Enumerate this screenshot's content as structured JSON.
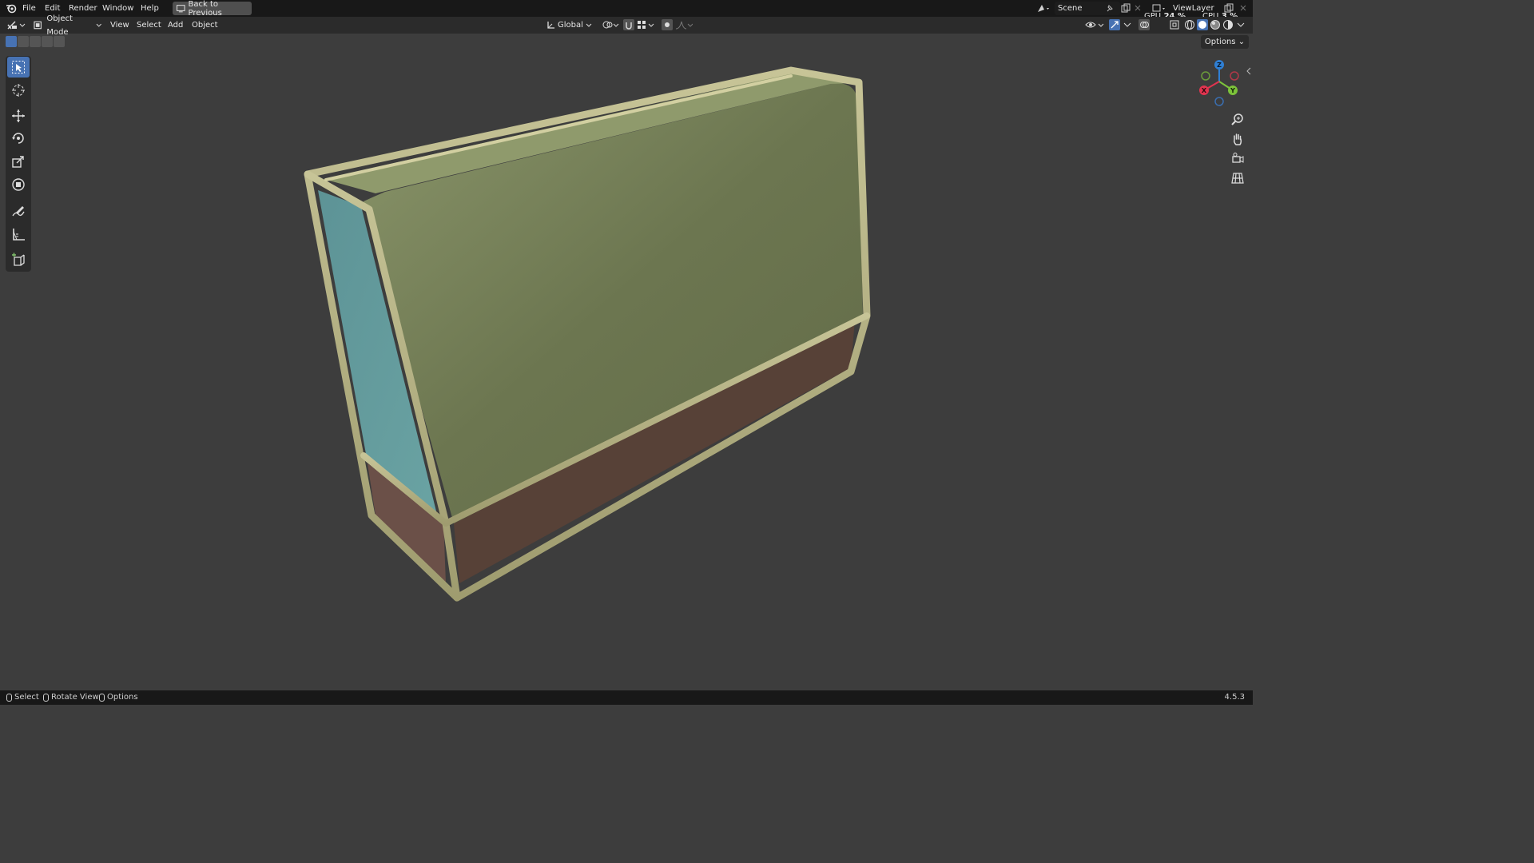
{
  "menu": {
    "items": [
      "File",
      "Edit",
      "Render",
      "Window",
      "Help"
    ],
    "back_label": "Back to Previous"
  },
  "scene": {
    "name": "Scene"
  },
  "view_layer": {
    "name": "ViewLayer"
  },
  "stats": {
    "gpu_label": "GPU",
    "gpu_value": "24 %",
    "cpu_label": "CPU",
    "cpu_value": "3 %"
  },
  "header": {
    "mode": "Object Mode",
    "menus": [
      "View",
      "Select",
      "Add",
      "Object"
    ],
    "orientation": "Global",
    "options": "Options"
  },
  "gizmo": {
    "x": "X",
    "y": "Y",
    "z": "Z"
  },
  "status": {
    "select": "Select",
    "rotate": "Rotate View",
    "options": "Options",
    "version": "4.5.3"
  },
  "colors": {
    "panel_green": "#6f7a52",
    "side_blue": "#5f9a9a",
    "bottom_brown": "#5a463e",
    "frame": "#b5b284",
    "accent": "#4772b3"
  }
}
